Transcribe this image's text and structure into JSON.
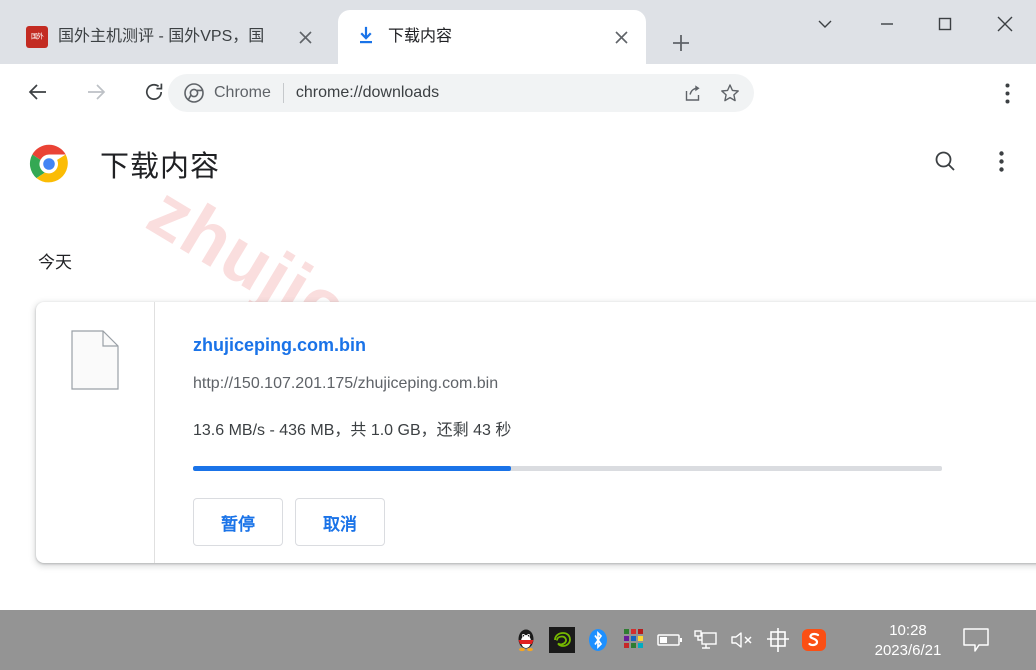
{
  "browser": {
    "tabs": [
      {
        "title": "国外主机测评 - 国外VPS，国",
        "favicon": "red-seal-favicon",
        "active": false,
        "close_label": "×"
      },
      {
        "title": "下载内容",
        "favicon": "download-arrow-icon",
        "active": true,
        "close_label": "×"
      }
    ],
    "new_tab_label": "+",
    "window_controls": {
      "tab_search": "tab-search-chevron",
      "minimize": "minimize",
      "maximize": "maximize",
      "close": "close"
    },
    "toolbar": {
      "back": "back-arrow",
      "forward": "forward-arrow",
      "reload": "reload",
      "omnibox": {
        "site_icon": "chrome-icon",
        "site_label": "Chrome",
        "url_scheme": "chrome://",
        "url_path": "downloads",
        "url_full": "chrome://downloads",
        "share": "share-icon",
        "bookmark": "star-icon"
      },
      "menu": "kebab-menu"
    }
  },
  "downloads_page": {
    "logo": "chrome-logo",
    "title": "下载内容",
    "search_label": "search",
    "menu_label": "more-options",
    "date_group": "今天",
    "watermark": "zhujiceping.com",
    "items": [
      {
        "file_icon": "generic-file-icon",
        "name": "zhujiceping.com.bin",
        "url": "http://150.107.201.175/zhujiceping.com.bin",
        "status": "13.6 MB/s - 436 MB，共 1.0 GB，还剩 43 秒",
        "speed": "13.6 MB/s",
        "downloaded": "436 MB",
        "total": "1.0 GB",
        "remaining": "43 秒",
        "progress_percent": 42.5,
        "buttons": [
          {
            "label": "暂停",
            "name": "pause"
          },
          {
            "label": "取消",
            "name": "cancel"
          }
        ]
      }
    ]
  },
  "taskbar": {
    "tray_icons": [
      "qq-icon",
      "nvidia-icon",
      "bluetooth-icon",
      "colorgrid-icon",
      "battery-icon",
      "network-display-icon",
      "speaker-muted-icon",
      "ime-chinese-icon",
      "sogou-icon"
    ],
    "ime_label": "中",
    "sogou_label": "S",
    "clock_time": "10:28",
    "clock_date": "2023/6/21",
    "notification_icon": "notification-bubble-icon"
  },
  "colors": {
    "accent_blue": "#1a73e8",
    "tabstrip_bg": "#dee1e6",
    "taskbar_bg": "#949494",
    "watermark": "#fadede",
    "progress_track": "#dadce0"
  }
}
